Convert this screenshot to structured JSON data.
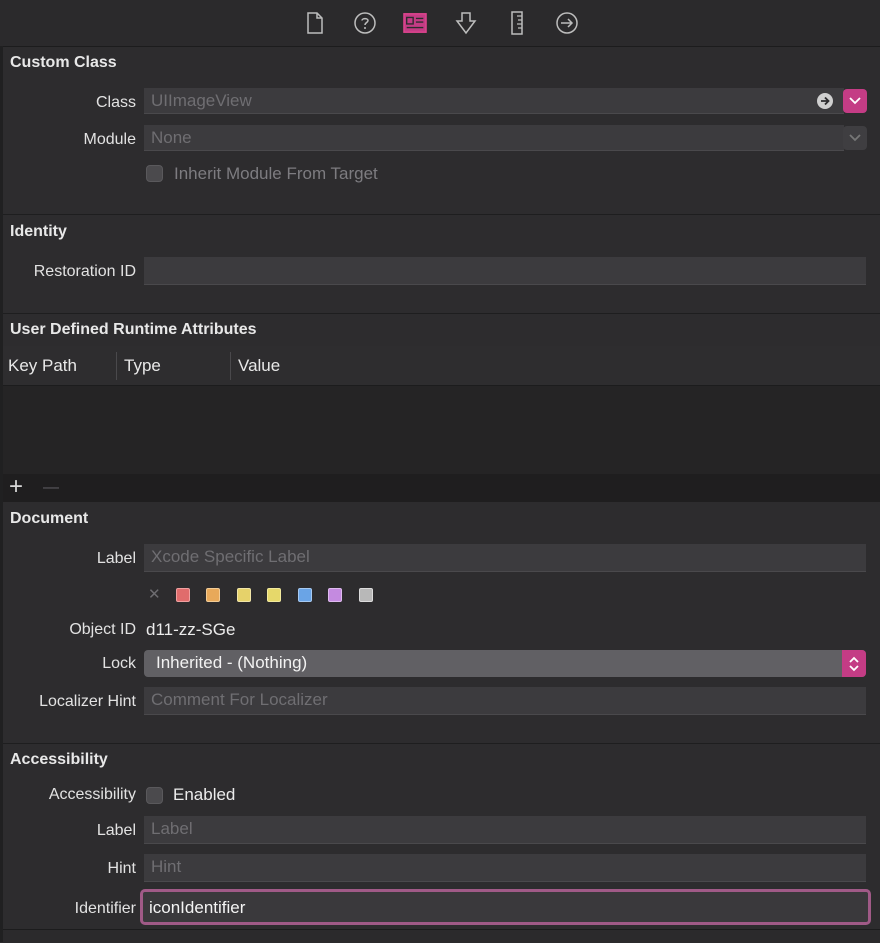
{
  "toolbar": {
    "icons": [
      "file-inspector-icon",
      "quick-help-icon",
      "identity-inspector-icon",
      "attributes-inspector-icon",
      "size-inspector-icon",
      "connections-inspector-icon"
    ],
    "active_color": "#e0458f"
  },
  "custom_class": {
    "title": "Custom Class",
    "class_label": "Class",
    "class_placeholder": "UIImageView",
    "module_label": "Module",
    "module_placeholder": "None",
    "inherit_label": "Inherit Module From Target"
  },
  "identity": {
    "title": "Identity",
    "restoration_label": "Restoration ID",
    "restoration_value": ""
  },
  "runtime_attributes": {
    "title": "User Defined Runtime Attributes",
    "columns": [
      "Key Path",
      "Type",
      "Value"
    ],
    "add_label": "+",
    "remove_label": "—"
  },
  "document": {
    "title": "Document",
    "label_label": "Label",
    "label_placeholder": "Xcode Specific Label",
    "clear_label": "✕",
    "swatches": [
      "#e06c6c",
      "#e8a95a",
      "#e6d26a",
      "#e6d86a",
      "#6aa4e6",
      "#c48ae0",
      "#b8b8b8"
    ],
    "object_id_label": "Object ID",
    "object_id_value": "d11-zz-SGe",
    "lock_label": "Lock",
    "lock_value": "Inherited - (Nothing)",
    "localizer_label": "Localizer Hint",
    "localizer_placeholder": "Comment For Localizer"
  },
  "accessibility": {
    "title": "Accessibility",
    "accessibility_label": "Accessibility",
    "enabled_label": "Enabled",
    "label_label": "Label",
    "label_placeholder": "Label",
    "hint_label": "Hint",
    "hint_placeholder": "Hint",
    "identifier_label": "Identifier",
    "identifier_value": "iconIdentifier"
  },
  "colors": {
    "accent": "#c43c85",
    "focus_ring": "#a05a87",
    "background": "#2d2c2e"
  }
}
